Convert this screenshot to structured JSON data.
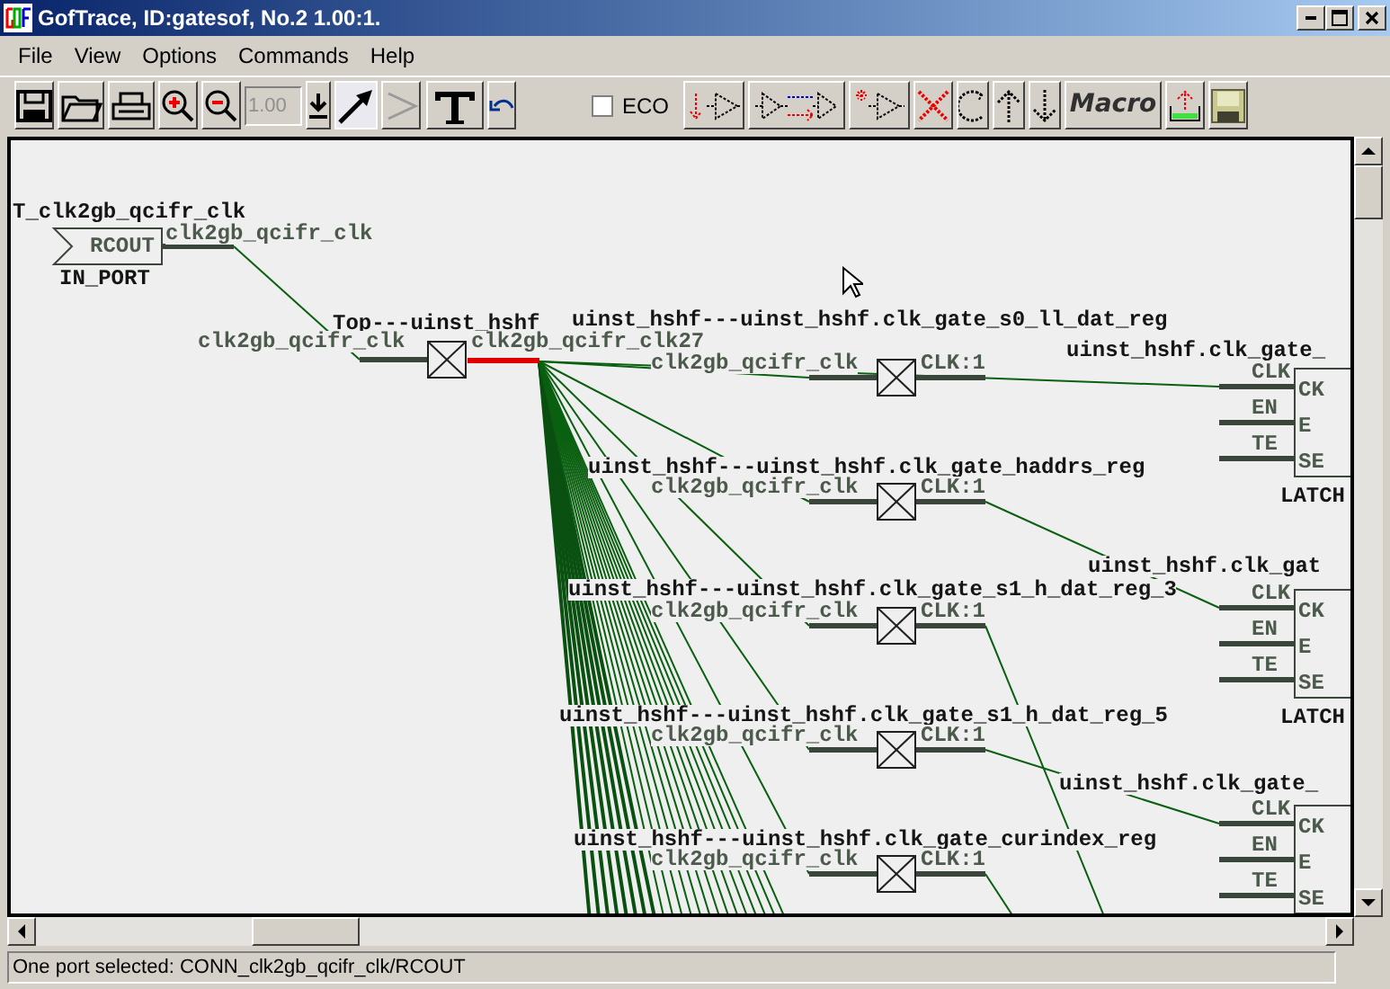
{
  "window": {
    "title": "GofTrace, ID:gatesof, No.2 1.00:1."
  },
  "menu": [
    "File",
    "View",
    "Options",
    "Commands",
    "Help"
  ],
  "toolbar": {
    "zoom_field": {
      "value": "1.00"
    },
    "pointer_tool": {
      "selected": true
    },
    "gate_tool": {
      "disabled": true
    },
    "eco_checkbox": {
      "label": "ECO",
      "checked": false
    },
    "macro_button": "Macro"
  },
  "schematic": {
    "port": {
      "name": "T_clk2gb_qcifr_clk",
      "pin": "RCOUT",
      "type": "IN_PORT",
      "net": "clk2gb_qcifr_clk"
    },
    "top_gate": {
      "instance": "Top---uinst_hshf",
      "input": "clk2gb_qcifr_clk",
      "output": "clk2gb_qcifr_clk27",
      "selected_wire": true
    },
    "gates": [
      {
        "instance": "uinst_hshf---uinst_hshf.clk_gate_s0_ll_dat_reg",
        "input": "clk2gb_qcifr_clk",
        "output": "CLK:1"
      },
      {
        "instance": "uinst_hshf---uinst_hshf.clk_gate_haddrs_reg",
        "input": "clk2gb_qcifr_clk",
        "output": "CLK:1"
      },
      {
        "instance": "uinst_hshf---uinst_hshf.clk_gate_s1_h_dat_reg_3",
        "input": "clk2gb_qcifr_clk",
        "output": "CLK:1"
      },
      {
        "instance": "uinst_hshf---uinst_hshf.clk_gate_s1_h_dat_reg_5",
        "input": "clk2gb_qcifr_clk",
        "output": "CLK:1"
      },
      {
        "instance": "uinst_hshf---uinst_hshf.clk_gate_curindex_reg",
        "input": "clk2gb_qcifr_clk",
        "output": "CLK:1"
      }
    ],
    "latches": [
      {
        "instance": "uinst_hshf.clk_gate_",
        "pins": [
          {
            "outer": "CLK",
            "inner": "CK"
          },
          {
            "outer": "EN",
            "inner": "E"
          },
          {
            "outer": "TE",
            "inner": "SE"
          }
        ],
        "type": "LATCH"
      },
      {
        "instance": "uinst_hshf.clk_gat",
        "pins": [
          {
            "outer": "CLK",
            "inner": "CK"
          },
          {
            "outer": "EN",
            "inner": "E"
          },
          {
            "outer": "TE",
            "inner": "SE"
          }
        ],
        "type": "LATCH"
      },
      {
        "instance": "uinst_hshf.clk_gate_",
        "pins": [
          {
            "outer": "CLK",
            "inner": "CK"
          },
          {
            "outer": "EN",
            "inner": "E"
          },
          {
            "outer": "TE",
            "inner": "SE"
          }
        ]
      }
    ]
  },
  "status_bar": "One port selected: CONN_clk2gb_qcifr_clk/RCOUT"
}
